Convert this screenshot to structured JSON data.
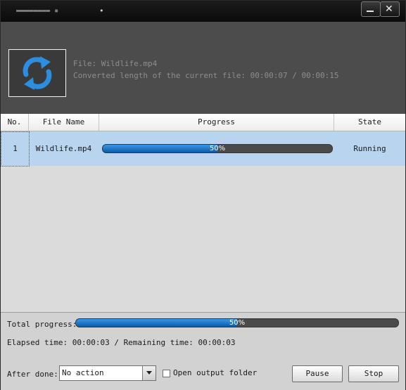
{
  "window": {
    "title_glyphs": "▬▬▬▬▬▬▬▬ ▪",
    "title_dot": "•",
    "close_glyph": "✕"
  },
  "info": {
    "file_line": "File: Wildlife.mp4",
    "length_line": "Converted length of the current file: 00:00:07 / 00:00:15"
  },
  "table": {
    "headers": {
      "no": "No.",
      "file_name": "File Name",
      "progress": "Progress",
      "state": "State"
    },
    "rows": [
      {
        "no": "1",
        "file_name": "Wildlife.mp4",
        "progress_fraction": 0.5,
        "progress_text": "50%",
        "state": "Running"
      }
    ]
  },
  "footer": {
    "total_label": "Total progress:",
    "total_fraction": 0.5,
    "total_text": "50%",
    "elapsed_line": "Elapsed time: 00:00:03 / Remaining time: 00:00:03",
    "after_done_label": "After done:",
    "after_done_value": "No action",
    "open_output_label": "Open output folder",
    "open_output_checked": false,
    "pause_label": "Pause",
    "stop_label": "Stop"
  },
  "colors": {
    "progress_fill": "#1f77c9",
    "selected_row": "#b9d4ef",
    "panel_dark": "#4c4c4c"
  }
}
